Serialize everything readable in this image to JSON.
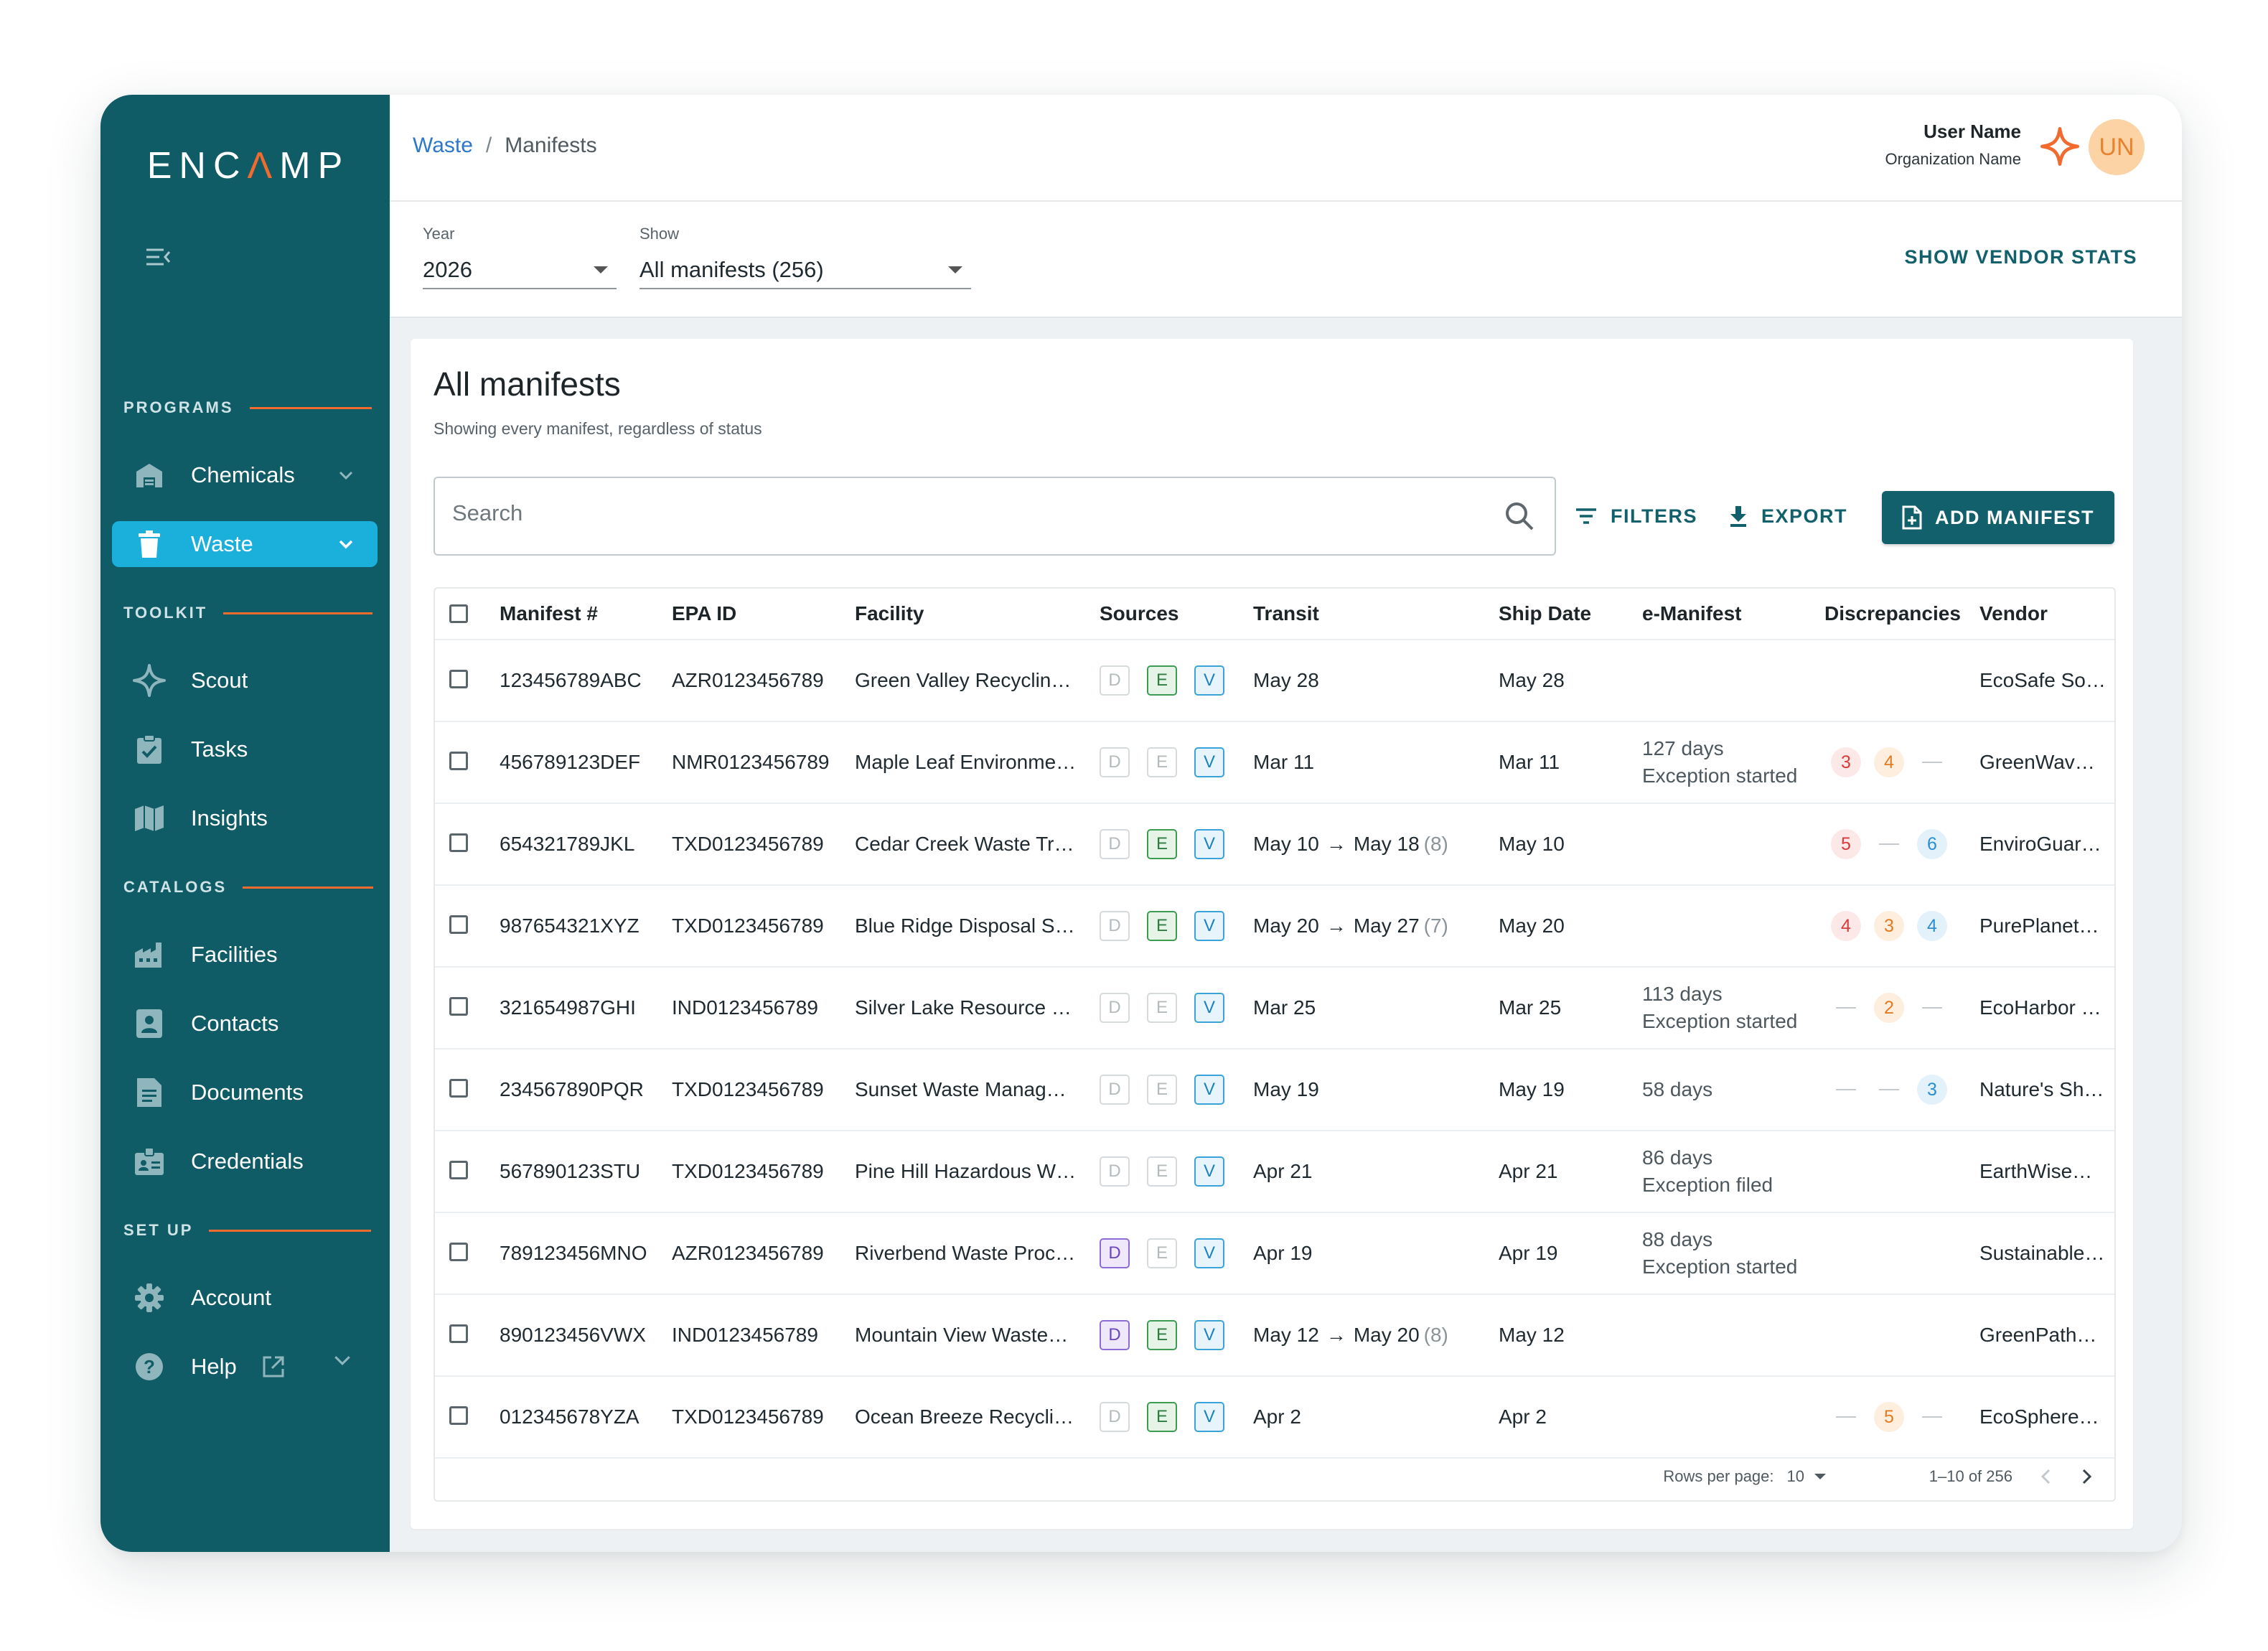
{
  "brand": {
    "logo_pre": "ENC",
    "logo_hat": "Λ",
    "logo_post": "MP",
    "accent": "#f26b2e",
    "sidebar_bg": "#0f5b66"
  },
  "sidebar": {
    "sections": {
      "programs": "PROGRAMS",
      "toolkit": "TOOLKIT",
      "catalogs": "CATALOGS",
      "setup": "SET UP"
    },
    "items": {
      "chemicals": {
        "label": "Chemicals",
        "icon": "warehouse-icon"
      },
      "waste": {
        "label": "Waste",
        "icon": "trash-icon",
        "active": true
      },
      "scout": {
        "label": "Scout",
        "icon": "sparkle-icon"
      },
      "tasks": {
        "label": "Tasks",
        "icon": "clipboard-check-icon"
      },
      "insights": {
        "label": "Insights",
        "icon": "map-icon"
      },
      "facilities": {
        "label": "Facilities",
        "icon": "factory-icon"
      },
      "contacts": {
        "label": "Contacts",
        "icon": "contact-card-icon"
      },
      "documents": {
        "label": "Documents",
        "icon": "document-icon"
      },
      "credentials": {
        "label": "Credentials",
        "icon": "badge-icon"
      },
      "account": {
        "label": "Account",
        "icon": "gear-icon"
      },
      "help": {
        "label": "Help",
        "icon": "help-icon"
      }
    }
  },
  "header": {
    "breadcrumb": {
      "parent": "Waste",
      "separator": "/",
      "current": "Manifests"
    },
    "user": {
      "name": "User Name",
      "org": "Organization Name",
      "initials": "UN"
    }
  },
  "filters": {
    "year": {
      "label": "Year",
      "value": "2026"
    },
    "show": {
      "label": "Show",
      "value": "All manifests (256)"
    },
    "vendor_stats": "SHOW VENDOR STATS"
  },
  "card": {
    "title": "All manifests",
    "subtitle": "Showing every manifest, regardless of status",
    "search_placeholder": "Search",
    "filters_btn": "FILTERS",
    "export_btn": "EXPORT",
    "add_btn": "ADD MANIFEST"
  },
  "table": {
    "columns": {
      "manifest": "Manifest #",
      "epa": "EPA ID",
      "facility": "Facility",
      "sources": "Sources",
      "transit": "Transit",
      "ship": "Ship Date",
      "emanifest": "e-Manifest",
      "discrepancies": "Discrepancies",
      "vendor": "Vendor"
    },
    "source_letters": [
      "D",
      "E",
      "V"
    ],
    "rows": [
      {
        "manifest": "123456789ABC",
        "epa": "AZR0123456789",
        "facility": "Green Valley Recycling…",
        "sources": [
          false,
          true,
          true
        ],
        "transit_start": "May 28",
        "transit_end": "",
        "transit_days": "",
        "ship": "May 28",
        "em1": "",
        "em2": "",
        "disc": [],
        "vendor": "EcoSafe So…"
      },
      {
        "manifest": "456789123DEF",
        "epa": "NMR0123456789",
        "facility": "Maple Leaf Environme…",
        "sources": [
          false,
          false,
          true
        ],
        "transit_start": "Mar 11",
        "transit_end": "",
        "transit_days": "",
        "ship": "Mar 11",
        "em1": "127 days",
        "em2": "Exception started",
        "disc": [
          [
            "red",
            "3"
          ],
          [
            "orange",
            "4"
          ],
          [
            "dash",
            ""
          ]
        ],
        "vendor": "GreenWave…"
      },
      {
        "manifest": "654321789JKL",
        "epa": "TXD0123456789",
        "facility": "Cedar Creek Waste Tre…",
        "sources": [
          false,
          true,
          true
        ],
        "transit_start": "May 10",
        "transit_end": "May 18",
        "transit_days": "(8)",
        "ship": "May 10",
        "em1": "",
        "em2": "",
        "disc": [
          [
            "red",
            "5"
          ],
          [
            "dash",
            ""
          ],
          [
            "blue",
            "6"
          ]
        ],
        "vendor": "EnviroGuar…"
      },
      {
        "manifest": "987654321XYZ",
        "epa": "TXD0123456789",
        "facility": "Blue Ridge Disposal Se…",
        "sources": [
          false,
          true,
          true
        ],
        "transit_start": "May 20",
        "transit_end": "May 27",
        "transit_days": "(7)",
        "ship": "May 20",
        "em1": "",
        "em2": "",
        "disc": [
          [
            "red",
            "4"
          ],
          [
            "orange",
            "3"
          ],
          [
            "blue",
            "4"
          ]
        ],
        "vendor": "PurePlanet…"
      },
      {
        "manifest": "321654987GHI",
        "epa": "IND0123456789",
        "facility": "Silver Lake Resource R…",
        "sources": [
          false,
          false,
          true
        ],
        "transit_start": "Mar 25",
        "transit_end": "",
        "transit_days": "",
        "ship": "Mar 25",
        "em1": "113 days",
        "em2": "Exception started",
        "disc": [
          [
            "dash",
            ""
          ],
          [
            "orange",
            "2"
          ],
          [
            "dash",
            ""
          ]
        ],
        "vendor": "EcoHarbor I…"
      },
      {
        "manifest": "234567890PQR",
        "epa": "TXD0123456789",
        "facility": "Sunset Waste Manage…",
        "sources": [
          false,
          false,
          true
        ],
        "transit_start": "May 19",
        "transit_end": "",
        "transit_days": "",
        "ship": "May 19",
        "em1": "58 days",
        "em2": "",
        "disc": [
          [
            "dash",
            ""
          ],
          [
            "dash",
            ""
          ],
          [
            "blue",
            "3"
          ]
        ],
        "vendor": "Nature's Sh…"
      },
      {
        "manifest": "567890123STU",
        "epa": "TXD0123456789",
        "facility": "Pine Hill Hazardous W…",
        "sources": [
          false,
          false,
          true
        ],
        "transit_start": "Apr 21",
        "transit_end": "",
        "transit_days": "",
        "ship": "Apr 21",
        "em1": "86 days",
        "em2": "Exception filed",
        "disc": [],
        "vendor": "EarthWise…"
      },
      {
        "manifest": "789123456MNO",
        "epa": "AZR0123456789",
        "facility": "Riverbend Waste Proce…",
        "sources": [
          true,
          false,
          true
        ],
        "transit_start": "Apr 19",
        "transit_end": "",
        "transit_days": "",
        "ship": "Apr 19",
        "em1": "88 days",
        "em2": "Exception started",
        "disc": [],
        "vendor": "Sustainable…"
      },
      {
        "manifest": "890123456VWX",
        "epa": "IND0123456789",
        "facility": "Mountain View Waste…",
        "sources": [
          true,
          true,
          true
        ],
        "transit_start": "May 12",
        "transit_end": "May 20",
        "transit_days": "(8)",
        "ship": "May 12",
        "em1": "",
        "em2": "",
        "disc": [],
        "vendor": "GreenPath…"
      },
      {
        "manifest": "012345678YZA",
        "epa": "TXD0123456789",
        "facility": "Ocean Breeze Recyclin…",
        "sources": [
          false,
          true,
          true
        ],
        "transit_start": "Apr 2",
        "transit_end": "",
        "transit_days": "",
        "ship": "Apr 2",
        "em1": "",
        "em2": "",
        "disc": [
          [
            "dash",
            ""
          ],
          [
            "orange",
            "5"
          ],
          [
            "dash",
            ""
          ]
        ],
        "vendor": "EcoSphere…"
      }
    ],
    "arrow": "→",
    "footer": {
      "rows_per_page_label": "Rows per page:",
      "rows_per_page": "10",
      "range": "1–10 of 256"
    }
  }
}
